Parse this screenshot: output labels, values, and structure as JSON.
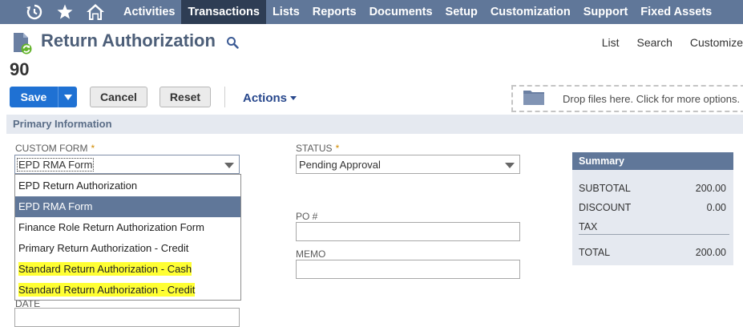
{
  "nav": {
    "items": [
      "Activities",
      "Transactions",
      "Lists",
      "Reports",
      "Documents",
      "Setup",
      "Customization",
      "Support",
      "Fixed Assets"
    ],
    "active_index": 1
  },
  "header": {
    "title": "Return Authorization",
    "links": [
      "List",
      "Search",
      "Customize"
    ],
    "record_number": "90"
  },
  "toolbar": {
    "save_label": "Save",
    "cancel_label": "Cancel",
    "reset_label": "Reset",
    "actions_label": "Actions",
    "dropzone_text": "Drop files here. Click for more options."
  },
  "section": {
    "title": "Primary Information"
  },
  "fields": {
    "custom_form_label": "CUSTOM FORM",
    "custom_form_value": "EPD RMA Form",
    "status_label": "STATUS",
    "status_value": "Pending Approval",
    "po_label": "PO #",
    "memo_label": "MEMO",
    "date_label": "DATE",
    "required_marker": "*"
  },
  "dropdown": {
    "options": [
      "EPD Return Authorization",
      "EPD RMA Form",
      "Finance Role Return Authorization Form",
      "Primary Return Authorization - Credit",
      "Standard Return Authorization - Cash",
      "Standard Return Authorization - Credit"
    ],
    "selected_index": 1,
    "highlighted_indices": [
      4,
      5
    ]
  },
  "summary": {
    "title": "Summary",
    "subtotal_label": "SUBTOTAL",
    "subtotal_value": "200.00",
    "discount_label": "DISCOUNT",
    "discount_value": "0.00",
    "tax_label": "TAX",
    "total_label": "TOTAL",
    "total_value": "200.00"
  },
  "colors": {
    "nav_bg": "#607799",
    "nav_active_bg": "#2e3d54",
    "primary_button": "#1f71d3",
    "highlight": "#ffff33",
    "required": "#d18b00"
  }
}
